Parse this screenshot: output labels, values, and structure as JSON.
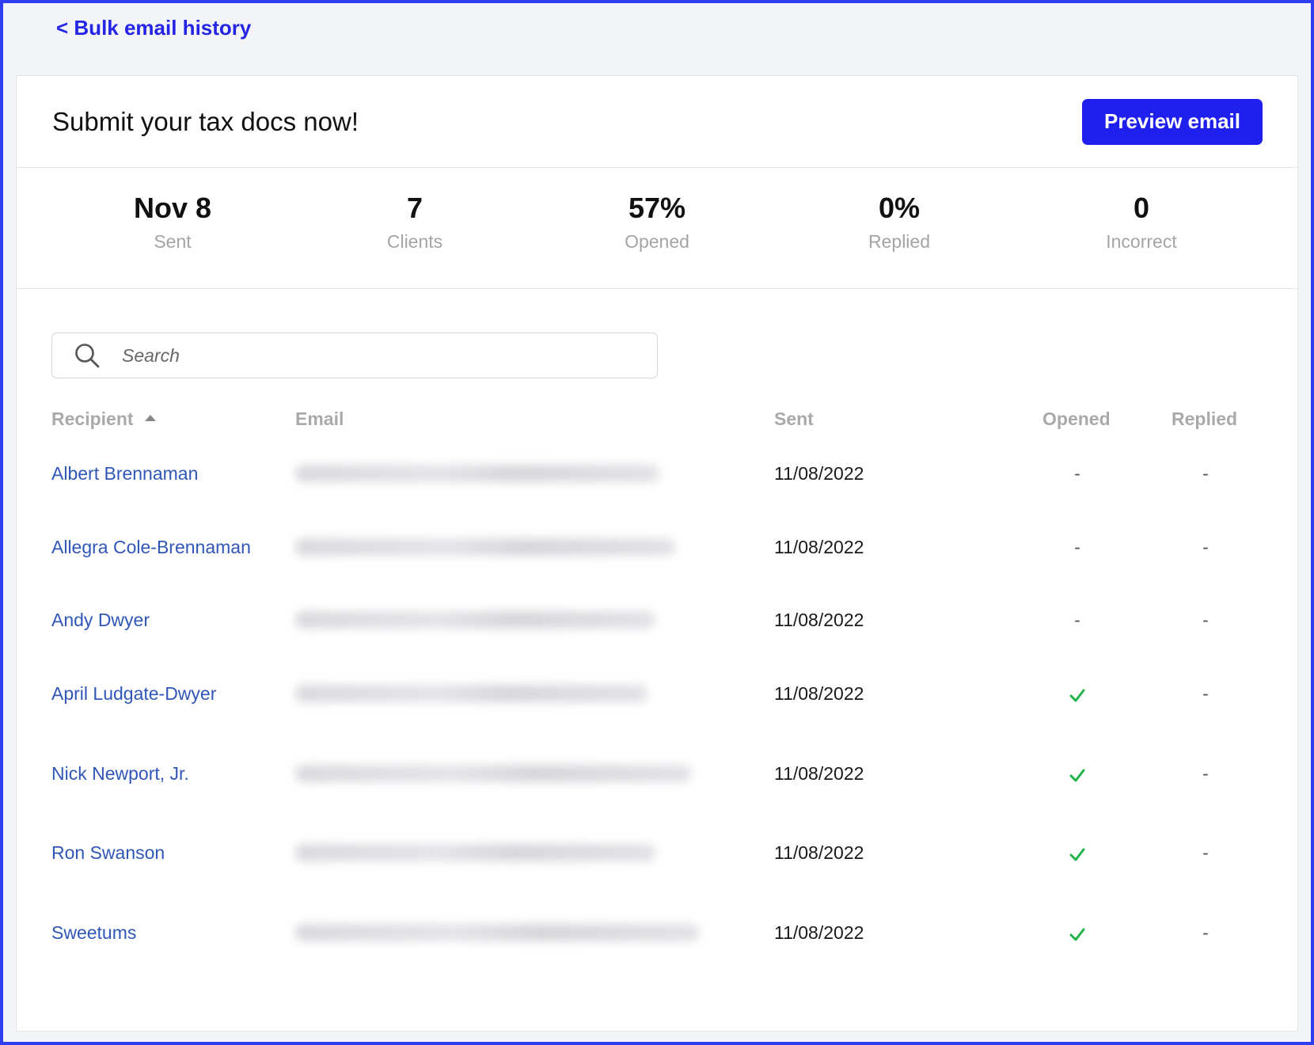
{
  "nav": {
    "back_label": "< Bulk email history"
  },
  "header": {
    "title": "Submit your tax docs now!",
    "preview_button": "Preview email"
  },
  "stats": [
    {
      "value": "Nov 8",
      "label": "Sent"
    },
    {
      "value": "7",
      "label": "Clients"
    },
    {
      "value": "57%",
      "label": "Opened"
    },
    {
      "value": "0%",
      "label": "Replied"
    },
    {
      "value": "0",
      "label": "Incorrect"
    }
  ],
  "search": {
    "placeholder": "Search",
    "value": ""
  },
  "table": {
    "columns": {
      "recipient": "Recipient",
      "email": "Email",
      "sent": "Sent",
      "opened": "Opened",
      "replied": "Replied"
    },
    "sort": {
      "column": "recipient",
      "direction": "ascending"
    },
    "rows": [
      {
        "recipient": "Albert Brennaman",
        "email": "",
        "sent": "11/08/2022",
        "opened": "-",
        "replied": "-"
      },
      {
        "recipient": "Allegra Cole-Brennaman",
        "email": "",
        "sent": "11/08/2022",
        "opened": "-",
        "replied": "-"
      },
      {
        "recipient": "Andy Dwyer",
        "email": "",
        "sent": "11/08/2022",
        "opened": "-",
        "replied": "-"
      },
      {
        "recipient": "April Ludgate-Dwyer",
        "email": "",
        "sent": "11/08/2022",
        "opened": "check-icon",
        "replied": "-"
      },
      {
        "recipient": "Nick Newport, Jr.",
        "email": "",
        "sent": "11/08/2022",
        "opened": "check-icon",
        "replied": "-"
      },
      {
        "recipient": "Ron Swanson",
        "email": "",
        "sent": "11/08/2022",
        "opened": "check-icon",
        "replied": "-"
      },
      {
        "recipient": "Sweetums",
        "email": "",
        "sent": "11/08/2022",
        "opened": "check-icon",
        "replied": "-"
      }
    ]
  },
  "colors": {
    "accent": "#2020ee",
    "link": "#3056b8",
    "check": "#1fb34a",
    "frame": "#2f3ff0"
  }
}
